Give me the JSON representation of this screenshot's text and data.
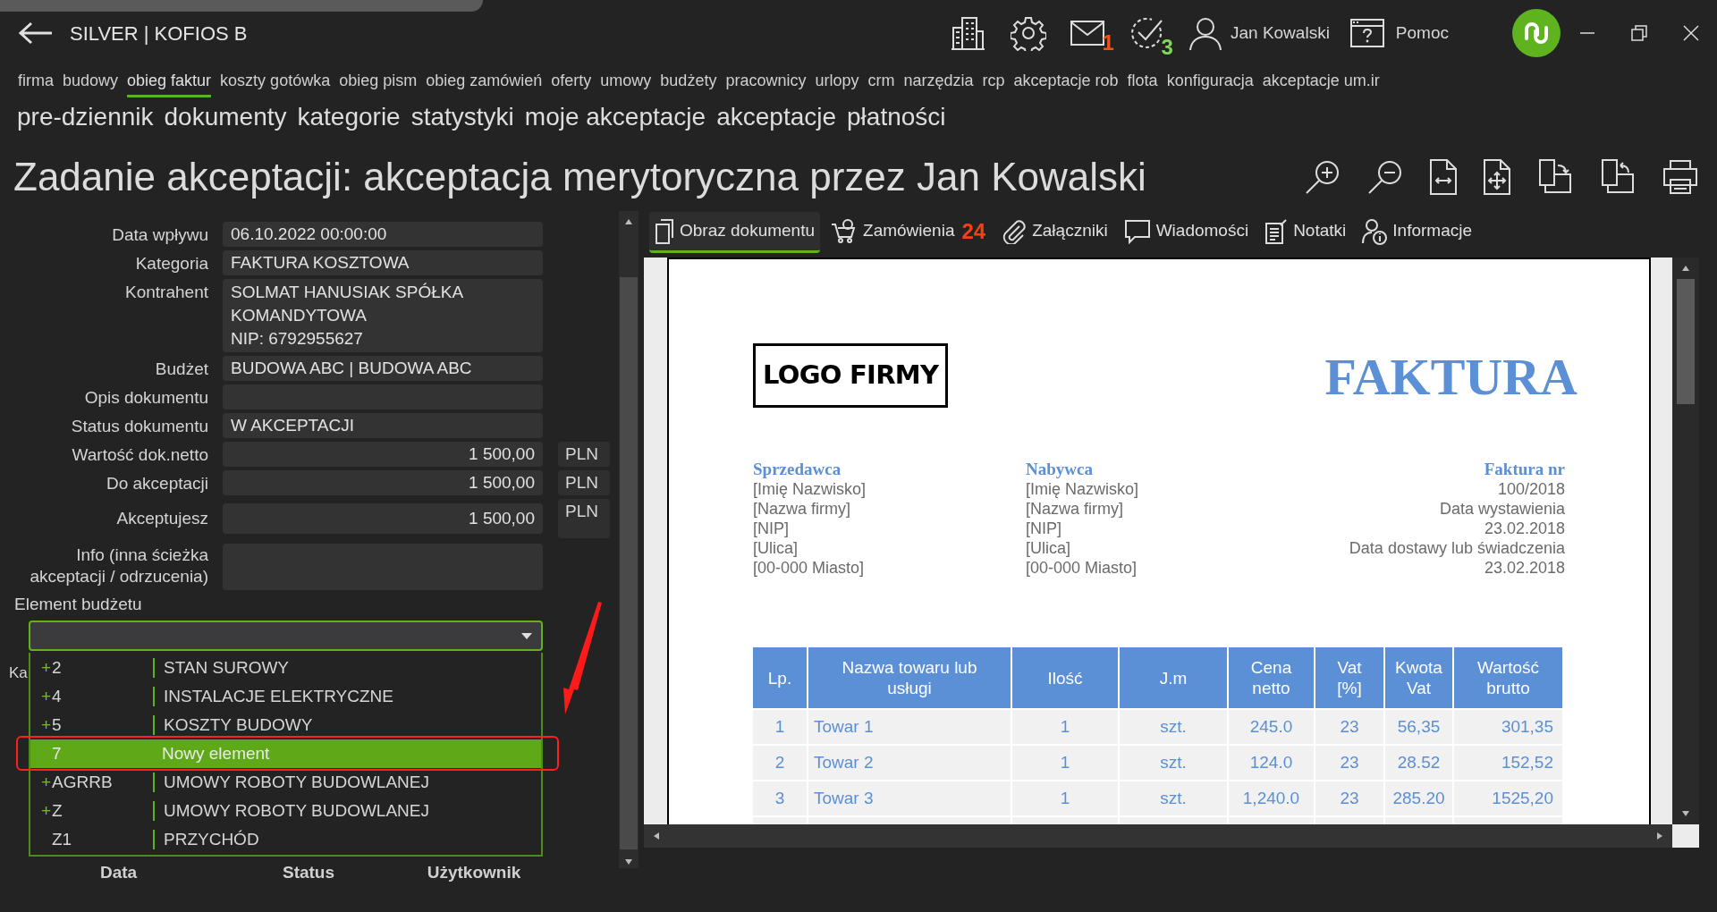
{
  "app": {
    "title": "SILVER | KOFIOS B"
  },
  "header": {
    "notifications": [
      {
        "kind": "mail",
        "count": "1",
        "color": "#e8541c"
      },
      {
        "kind": "tasks",
        "count": "3",
        "color": "#7ed957"
      }
    ],
    "user": "Jan Kowalski",
    "help": "Pomoc"
  },
  "main_menu": [
    {
      "label": "firma",
      "selected": false
    },
    {
      "label": "budowy",
      "selected": false
    },
    {
      "label": "obieg faktur",
      "selected": true
    },
    {
      "label": "koszty gotówka",
      "selected": false
    },
    {
      "label": "obieg pism",
      "selected": false
    },
    {
      "label": "obieg zamówień",
      "selected": false
    },
    {
      "label": "oferty",
      "selected": false
    },
    {
      "label": "umowy",
      "selected": false
    },
    {
      "label": "budżety",
      "selected": false
    },
    {
      "label": "pracownicy",
      "selected": false
    },
    {
      "label": "urlopy",
      "selected": false
    },
    {
      "label": "crm",
      "selected": false
    },
    {
      "label": "narzędzia",
      "selected": false
    },
    {
      "label": "rcp",
      "selected": false
    },
    {
      "label": "akceptacje rob",
      "selected": false
    },
    {
      "label": "flota",
      "selected": false
    },
    {
      "label": "konfiguracja",
      "selected": false
    },
    {
      "label": "akceptacje um.ir",
      "selected": false
    }
  ],
  "sub_menu": [
    "pre-dziennik",
    "dokumenty",
    "kategorie",
    "statystyki",
    "moje akceptacje",
    "akceptacje",
    "płatności"
  ],
  "page_title": "Zadanie akceptacji: akceptacja merytoryczna przez Jan Kowalski",
  "form": {
    "fields": [
      {
        "label": "Data wpływu",
        "value": "06.10.2022 00:00:00",
        "kind": "text"
      },
      {
        "label": "Kategoria",
        "value": "FAKTURA KOSZTOWA",
        "kind": "text"
      },
      {
        "label": "Kontrahent",
        "lines": [
          "SOLMAT HANUSIAK SPÓŁKA",
          "KOMANDYTOWA",
          "NIP: 6792955627"
        ],
        "kind": "text"
      },
      {
        "label": "Budżet",
        "value": "BUDOWA ABC | BUDOWA ABC",
        "kind": "text"
      },
      {
        "label": "Opis dokumentu",
        "kind": "text"
      },
      {
        "label": "Status dokumentu",
        "value": "W AKCEPTACJI",
        "kind": "text"
      },
      {
        "label": "Wartość dok.netto",
        "value": "1 500,00",
        "currency": "PLN",
        "kind": "amount"
      },
      {
        "label": "Do akceptacji",
        "value": "1 500,00",
        "currency": "PLN",
        "kind": "amount"
      },
      {
        "label": "Akceptujesz",
        "value": "1 500,00",
        "currency": "PLN",
        "kind": "amount_input"
      },
      {
        "label": "Info (inna ścieżka akceptacji / odrzucenia)",
        "kind": "textarea"
      }
    ]
  },
  "budget_element": {
    "label": "Element budżetu",
    "expanded": true,
    "covered_label": "Ka",
    "options": [
      {
        "prefix": "+",
        "code": "2",
        "name": "STAN SUROWY",
        "selected": false
      },
      {
        "prefix": "+",
        "code": "4",
        "name": "INSTALACJE ELEKTRYCZNE",
        "selected": false
      },
      {
        "prefix": "+",
        "code": "5",
        "name": "KOSZTY BUDOWY",
        "selected": false
      },
      {
        "code": "7",
        "name": "Nowy element",
        "selected": true
      },
      {
        "prefix": "+",
        "code": "AGRRB",
        "name": "UMOWY ROBOTY BUDOWLANEJ",
        "selected": false
      },
      {
        "prefix": "+",
        "code": "Z",
        "name": "UMOWY ROBOTY BUDOWLANEJ",
        "selected": false
      },
      {
        "code": "Z1",
        "name": "PRZYCHÓD",
        "selected": false
      }
    ]
  },
  "history_columns": [
    "Data",
    "Status",
    "Użytkownik"
  ],
  "viewer_tabs": [
    {
      "label": "Obraz dokumentu",
      "kind": "document",
      "selected": true
    },
    {
      "label": "Zamówienia",
      "kind": "cart",
      "badge": "24",
      "selected": false
    },
    {
      "label": "Załączniki",
      "kind": "clip",
      "selected": false
    },
    {
      "label": "Wiadomości",
      "kind": "chat",
      "selected": false
    },
    {
      "label": "Notatki",
      "kind": "notes",
      "selected": false
    },
    {
      "label": "Informacje",
      "kind": "info",
      "selected": false
    }
  ],
  "invoice": {
    "logo": "LOGO FIRMY",
    "title": "FAKTURA",
    "parties": [
      {
        "heading": "Sprzedawca",
        "lines": [
          "[Imię Nazwisko]",
          "[Nazwa firmy]",
          "[NIP]",
          "[Ulica]",
          "[00-000 Miasto]"
        ]
      },
      {
        "heading": "Nabywca",
        "lines": [
          "[Imię Nazwisko]",
          "[Nazwa firmy]",
          "[NIP]",
          "[Ulica]",
          "[00-000 Miasto]"
        ]
      },
      {
        "heading": "Faktura nr",
        "lines": [
          "100/2018",
          "Data wystawienia",
          "23.02.2018",
          "Data dostawy lub świadczenia",
          "23.02.2018"
        ]
      }
    ],
    "columns": [
      "Lp.",
      "Nazwa towaru lub usługi",
      "Ilość",
      "J.m",
      "Cena netto",
      "Vat [%]",
      "Kwota Vat",
      "Wartość brutto"
    ],
    "rows": [
      [
        "1",
        "Towar 1",
        "1",
        "szt.",
        "245.0",
        "23",
        "56,35",
        "301,35"
      ],
      [
        "2",
        "Towar 2",
        "1",
        "szt.",
        "124.0",
        "23",
        "28.52",
        "152,52"
      ],
      [
        "3",
        "Towar 3",
        "1",
        "szt.",
        "1,240.0",
        "23",
        "285.20",
        "1525,20"
      ],
      [
        "",
        "",
        "",
        "",
        "",
        "",
        "",
        ""
      ]
    ]
  }
}
